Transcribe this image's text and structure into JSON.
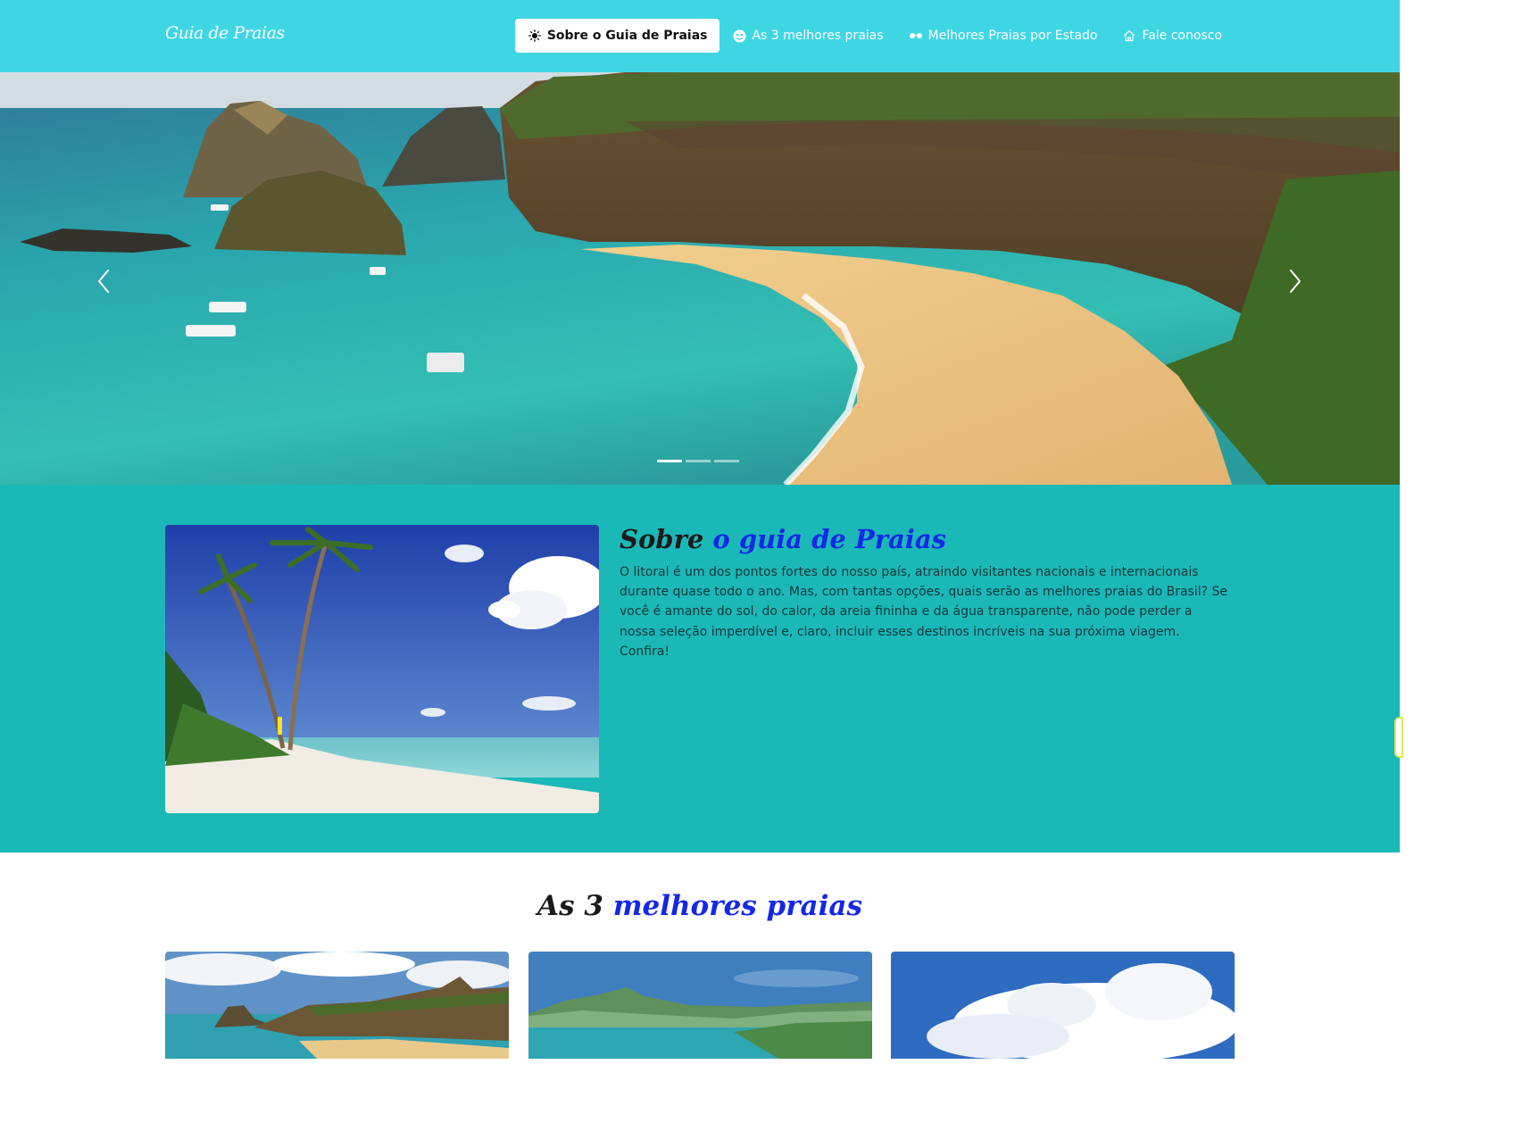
{
  "brand": "Guia de Praias",
  "nav": [
    {
      "label": "Sobre o Guia de Praias",
      "icon": "sun-icon",
      "active": true
    },
    {
      "label": "As 3 melhores praias",
      "icon": "smiley-icon",
      "active": false
    },
    {
      "label": "Melhores Praias por Estado",
      "icon": "sunglasses-icon",
      "active": false
    },
    {
      "label": "Fale conosco",
      "icon": "house-icon",
      "active": false
    }
  ],
  "hero": {
    "slides": 3,
    "active_slide": 1,
    "prev_icon": "chevron-left-icon",
    "next_icon": "chevron-right-icon"
  },
  "about": {
    "title_plain": "Sobre",
    "title_highlight": "o guia de Praias",
    "text": "O litoral é um dos pontos fortes do nosso país, atraindo visitantes nacionais e internacionais durante quase todo o ano. Mas, com tantas opções, quais serão as melhores praias do Brasil? Se você é amante do sol, do calor, da areia fininha e da água transparente, não pode perder a nossa seleção imperdível e, claro, incluir esses destinos incríveis na sua próxima viagem. Confira!"
  },
  "top3": {
    "title_plain": "As 3",
    "title_highlight": "melhores praias"
  },
  "colors": {
    "navbar": "#3fd6e4",
    "about_bg": "#1bb8b8",
    "highlight": "#1428e6"
  }
}
